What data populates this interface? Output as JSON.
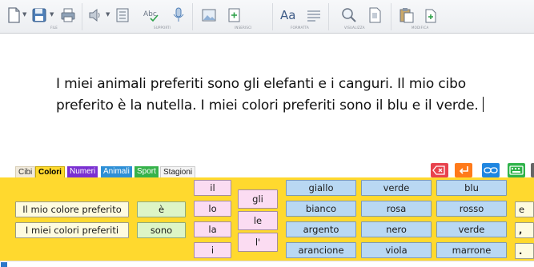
{
  "toolbar": {
    "groups": [
      "FILE",
      "SUPPORTI",
      "INSERISCI",
      "FORMATTA",
      "VISUALIZZA",
      "MODIFICA"
    ],
    "font_button_label": "Aa"
  },
  "document": {
    "text": "I miei animali preferiti sono gli elefanti e i canguri. Il mio cibo preferito è la nutella. I miei colori preferiti sono il blu e il verde."
  },
  "tabs": [
    {
      "label": "Cibi",
      "color": "#f1eadb"
    },
    {
      "label": "Colori",
      "color": "#ffd92e",
      "active": true
    },
    {
      "label": "Numeri",
      "color": "#7a2fd1"
    },
    {
      "label": "Animali",
      "color": "#2d8fd6"
    },
    {
      "label": "Sport",
      "color": "#36b24a"
    },
    {
      "label": "Stagioni",
      "color": "#f4f4f4"
    }
  ],
  "actions": {
    "delete_icon": "backspace-icon",
    "enter_icon": "enter-icon",
    "link_icon": "link-icon",
    "keyboard_icon": "keyboard-icon"
  },
  "words": {
    "phrases": [
      "Il mio colore preferito",
      "I miei colori preferiti"
    ],
    "verbs": [
      "è",
      "sono"
    ],
    "articles": [
      "il",
      "lo",
      "la",
      "i"
    ],
    "articles_plural": [
      "gli",
      "le",
      "l'"
    ],
    "colors": [
      [
        "giallo",
        "verde",
        "blu"
      ],
      [
        "bianco",
        "rosa",
        "rosso"
      ],
      [
        "argento",
        "nero",
        "verde"
      ],
      [
        "arancione",
        "viola",
        "marrone"
      ]
    ],
    "extra": [
      "e",
      ",",
      "."
    ]
  },
  "colors": {
    "panel_bg": "#ffd92e",
    "word_bg": "#fefbdf",
    "pink": "#fbdcf2",
    "blue": "#b9d8f3",
    "green": "#ddf5c6"
  }
}
